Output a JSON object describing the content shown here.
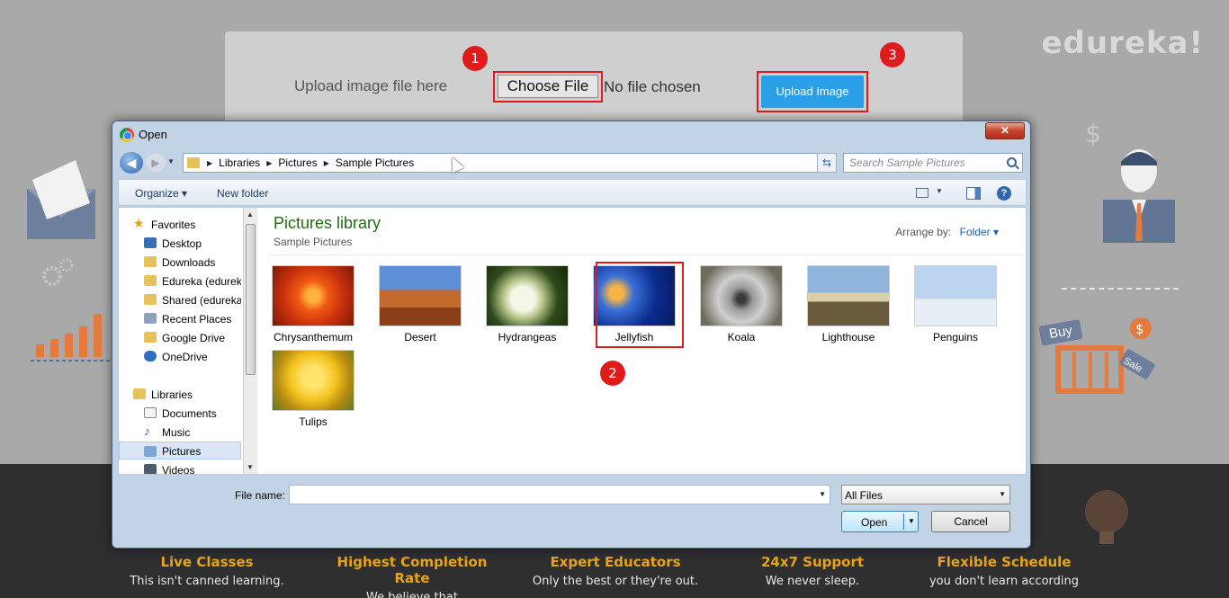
{
  "page": {
    "brand": "edureka!",
    "upload_label": "Upload image file here",
    "choose_file": "Choose File",
    "no_file": "No file chosen",
    "upload_button": "Upload Image",
    "badges": [
      "1",
      "2",
      "3"
    ],
    "features": [
      {
        "title": "Live Classes",
        "desc": "This isn't canned learning."
      },
      {
        "title": "Highest Completion Rate",
        "desc": "We believe that"
      },
      {
        "title": "Expert Educators",
        "desc": "Only the best or they're out."
      },
      {
        "title": "24x7 Support",
        "desc": "We never sleep."
      },
      {
        "title": "Flexible Schedule",
        "desc": "you don't learn according"
      }
    ],
    "deco_buy": "Buy",
    "deco_sale": "Sale"
  },
  "dialog": {
    "title": "Open",
    "close": "✕",
    "breadcrumbs": [
      "Libraries",
      "Pictures",
      "Sample Pictures"
    ],
    "search_placeholder": "Search Sample Pictures",
    "toolbar": {
      "organize": "Organize ▾",
      "new_folder": "New folder"
    },
    "nav": {
      "favorites": "Favorites",
      "items": [
        "Desktop",
        "Downloads",
        "Edureka (edurek",
        "Shared (edureka",
        "Recent Places",
        "Google Drive",
        "OneDrive"
      ],
      "libraries": "Libraries",
      "lib_items": [
        "Documents",
        "Music",
        "Pictures",
        "Videos"
      ]
    },
    "library_title": "Pictures library",
    "library_sub": "Sample Pictures",
    "arrange_label": "Arrange by:",
    "arrange_value": "Folder ▾",
    "files": [
      "Chrysanthemum",
      "Desert",
      "Hydrangeas",
      "Jellyfish",
      "Koala",
      "Lighthouse",
      "Penguins",
      "Tulips"
    ],
    "file_name_label": "File name:",
    "file_name_value": "",
    "file_type": "All Files",
    "open": "Open",
    "cancel": "Cancel"
  },
  "colors": {
    "accent": "#2a9ee6",
    "highlight": "#e01b1b",
    "feature_title": "#e8a417"
  }
}
